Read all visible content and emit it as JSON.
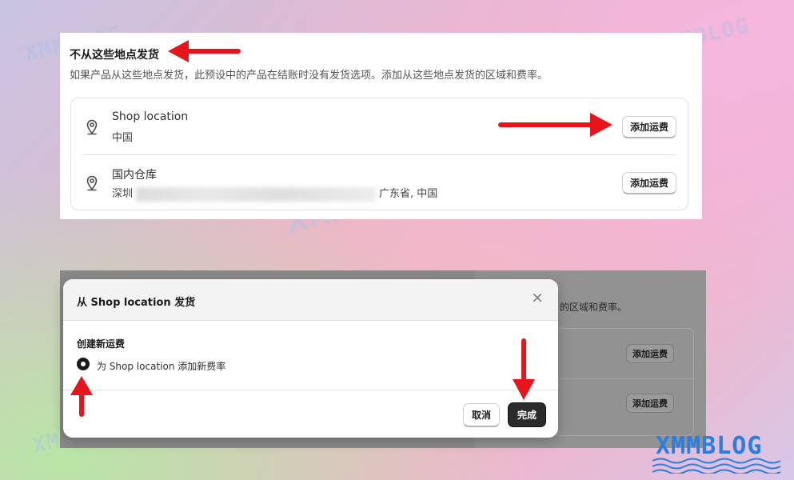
{
  "top_panel": {
    "title": "不从这些地点发货",
    "description": "如果产品从这些地点发货，此预设中的产品在结账时没有发货选项。添加从这些地点发货的区域和费率。",
    "locations": [
      {
        "name": "Shop location",
        "address": "中国",
        "button": "添加运费"
      },
      {
        "name": "国内仓库",
        "address_prefix": "深圳",
        "address_suffix": "广东省, 中国",
        "button": "添加运费"
      }
    ]
  },
  "background_card": {
    "description": "的区域和费率。",
    "buttons": [
      "添加运费",
      "添加运费"
    ]
  },
  "modal": {
    "title": "从 Shop location 发货",
    "close_label": "×",
    "subtitle": "创建新运费",
    "radio_label": "为 Shop location 添加新费率",
    "cancel_label": "取消",
    "done_label": "完成"
  },
  "watermark": {
    "text": "XMMBLOG",
    "brand": "XMMBLOG",
    "brand_color": "#2c7de0"
  },
  "colors": {
    "arrow": "#e8141c",
    "primary_button": "#2b2b2b"
  },
  "icons": {
    "location": "map-pin-icon",
    "close": "close-icon",
    "annotation": "red-arrow-icon"
  }
}
